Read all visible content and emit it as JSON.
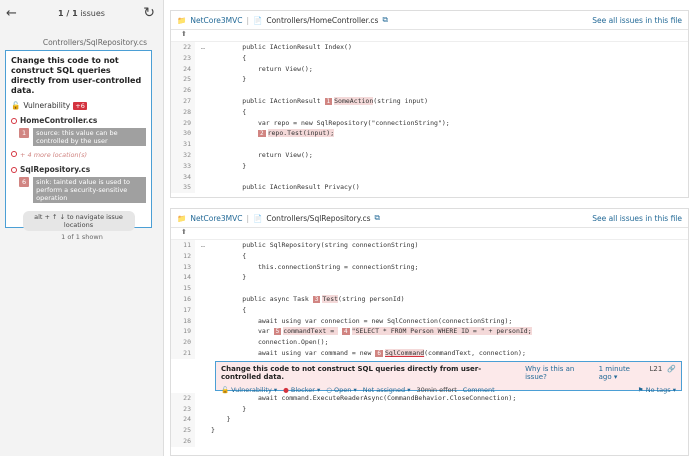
{
  "nav": {
    "back_icon": "arrow-left-icon",
    "count_current": "1 / 1",
    "count_label": "issues",
    "refresh_icon": "refresh-icon"
  },
  "sidebar": {
    "path": "Controllers/SqlRepository.cs",
    "issue": {
      "title": "Change this code to not construct SQL queries directly from user-controlled data.",
      "type": "Vulnerability",
      "badge": "+6",
      "files": [
        {
          "name": "HomeController.cs",
          "flows": [
            {
              "num": "1",
              "text": "source: this value can be controlled by the user"
            }
          ]
        },
        {
          "name": "SqlRepository.cs",
          "flows": [
            {
              "num": "6",
              "text": "sink: tainted value is used to perform a security-sensitive operation"
            }
          ]
        }
      ],
      "more": "+ 4 more location(s)",
      "hint": "alt + ↑ ↓ to navigate issue locations"
    },
    "shown": "1 of 1 shown"
  },
  "panels": [
    {
      "project": "NetCore3MVC",
      "file": "Controllers/HomeController.cs",
      "see_all": "See all issues in this file",
      "lines": [
        {
          "n": "22",
          "g": "…",
          "code": "        public IActionResult Index()"
        },
        {
          "n": "23",
          "code": "        {"
        },
        {
          "n": "24",
          "code": "            return View();"
        },
        {
          "n": "25",
          "code": "        }"
        },
        {
          "n": "26",
          "code": ""
        },
        {
          "n": "27",
          "code": "        public IActionResult ",
          "loc": "1",
          "after": "SomeAction",
          "rest": "(string input)"
        },
        {
          "n": "28",
          "code": "        {"
        },
        {
          "n": "29",
          "code": "            var repo = new SqlRepository(\"connectionString\");"
        },
        {
          "n": "30",
          "code": "            ",
          "loc": "2",
          "after": "repo.Test(input);",
          "rest": ""
        },
        {
          "n": "31",
          "code": ""
        },
        {
          "n": "32",
          "code": "            return View();"
        },
        {
          "n": "33",
          "code": "        }"
        },
        {
          "n": "34",
          "code": ""
        },
        {
          "n": "35",
          "code": "        public IActionResult Privacy()"
        }
      ]
    },
    {
      "project": "NetCore3MVC",
      "file": "Controllers/SqlRepository.cs",
      "see_all": "See all issues in this file",
      "lines": [
        {
          "n": "11",
          "g": "…",
          "code": "        public SqlRepository(string connectionString)"
        },
        {
          "n": "12",
          "code": "        {"
        },
        {
          "n": "13",
          "code": "            this.connectionString = connectionString;"
        },
        {
          "n": "14",
          "code": "        }"
        },
        {
          "n": "15",
          "code": ""
        },
        {
          "n": "16",
          "code": "        public async Task ",
          "loc": "3",
          "after": "Test",
          "rest": "(string personId)"
        },
        {
          "n": "17",
          "code": "        {"
        },
        {
          "n": "18",
          "code": "            await using var connection = new SqlConnection(connectionString);"
        },
        {
          "n": "19",
          "code": "            var ",
          "loc": "5",
          "after": "commandText = ",
          "loc2": "4",
          "after2": "\"SELECT * FROM Person WHERE ID = \" + personId;"
        },
        {
          "n": "20",
          "code": "            connection.Open();"
        },
        {
          "n": "21",
          "code": "            await using var command = new ",
          "loc": "6",
          "after": "SqlCommand",
          "rest": "(commandText, connection);"
        }
      ],
      "issue_box": {
        "title": "Change this code to not construct SQL queries directly from user-controlled data.",
        "why": "Why is this an issue?",
        "time": "1 minute ago",
        "line": "L21",
        "type": "Vulnerability",
        "severity": "Blocker",
        "status": "Open",
        "assignee": "Not assigned",
        "effort": "30min effort",
        "comment": "Comment",
        "tags": "No tags"
      },
      "lines_after": [
        {
          "n": "22",
          "code": "            await command.ExecuteReaderAsync(CommandBehavior.CloseConnection);"
        },
        {
          "n": "23",
          "code": "        }"
        },
        {
          "n": "24",
          "code": "    }"
        },
        {
          "n": "25",
          "code": "}"
        },
        {
          "n": "26",
          "code": ""
        }
      ]
    }
  ]
}
